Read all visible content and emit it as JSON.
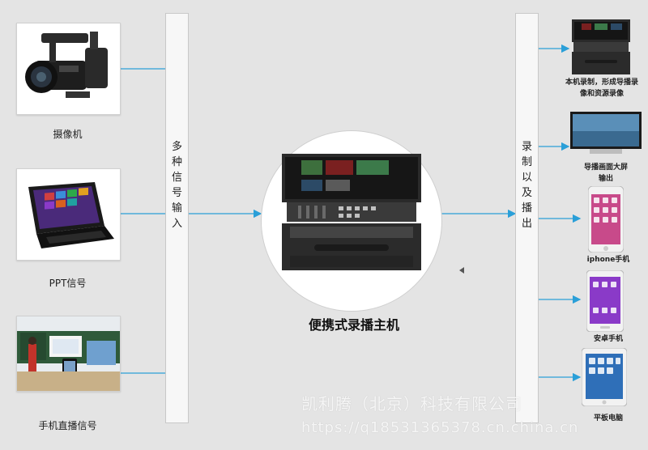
{
  "inputs": [
    {
      "label": "摄像机"
    },
    {
      "label": "PPT信号"
    },
    {
      "label": "手机直播信号"
    }
  ],
  "input_bar": {
    "chars": [
      "多",
      "种",
      "信",
      "号",
      "输",
      "入"
    ]
  },
  "host": {
    "label": "便携式录播主机"
  },
  "output_bar": {
    "chars": [
      "录",
      "制",
      "以",
      "及",
      "播",
      "出"
    ]
  },
  "outputs": [
    {
      "label_line1": "本机录制，形成导播录",
      "label_line2": "像和资源录像"
    },
    {
      "label_line1": "导播画面大屏",
      "label_line2": "输出"
    },
    {
      "label": "iphone手机"
    },
    {
      "label": "安卓手机"
    },
    {
      "label": "平板电脑"
    }
  ],
  "watermark": {
    "line1": "凯利腾（北京）科技有限公司",
    "line2": "https://q18531365378.cn.china.cn"
  },
  "colors": {
    "arrow": "#2a9fd8",
    "background": "#e4e4e4"
  },
  "icons": [
    "video-camera-icon",
    "laptop-icon",
    "classroom-photo",
    "recorder-device-icon",
    "monitor-icon",
    "iphone-icon",
    "android-phone-icon",
    "tablet-icon"
  ]
}
